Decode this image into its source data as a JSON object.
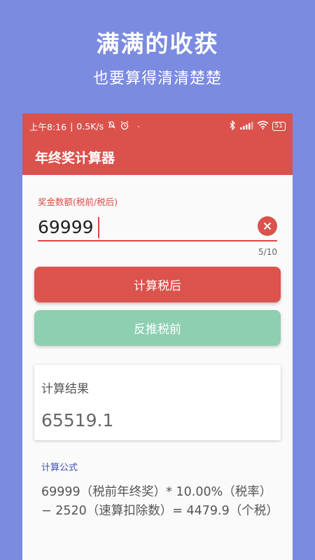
{
  "promo": {
    "title": "满满的收获",
    "subtitle": "也要算得清清楚楚"
  },
  "status_bar": {
    "time": "上午8:16",
    "speed": "0.5K/s",
    "battery": "51"
  },
  "app_bar": {
    "title": "年终奖计算器"
  },
  "form": {
    "label": "奖金数额(税前/税后)",
    "value": "69999",
    "counter": "5/10"
  },
  "buttons": {
    "calc_after_tax": "计算税后",
    "calc_before_tax": "反推税前"
  },
  "result": {
    "label": "计算结果",
    "value": "65519.1"
  },
  "formula": {
    "title": "计算公式",
    "text": "69999（税前年终奖）* 10.00%（税率）− 2520（速算扣除数）= 4479.9（个税）"
  },
  "colors": {
    "background": "#7b8be0",
    "primary": "#db524d",
    "secondary": "#8ecfb2",
    "link": "#3f51b5"
  },
  "icons": [
    "clock-icon",
    "bell-off-icon",
    "alarm-icon",
    "bluetooth-icon",
    "signal-icon",
    "wifi-icon",
    "battery-icon",
    "clear-icon"
  ]
}
